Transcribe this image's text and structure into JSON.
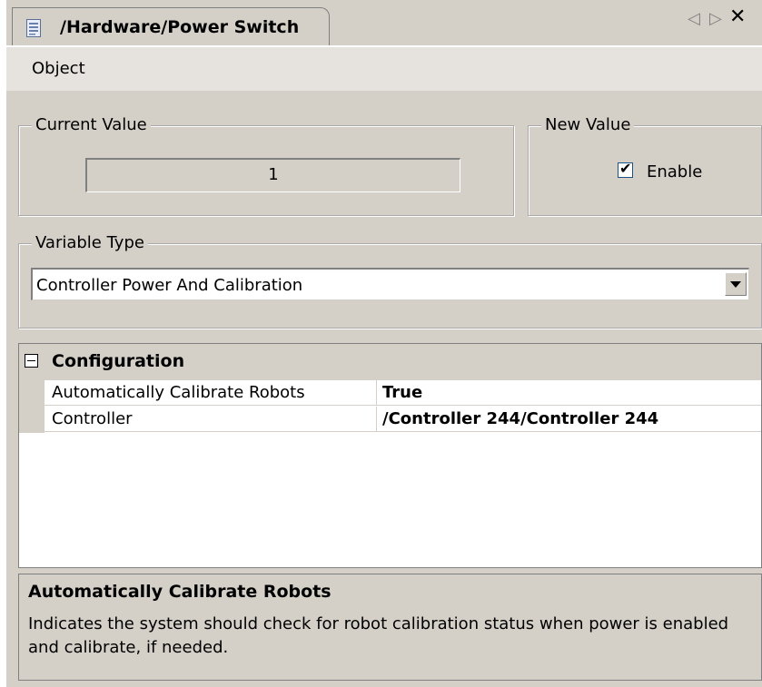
{
  "window": {
    "tab_title": "/Hardware/Power Switch",
    "tab_icon": "document-icon",
    "nav_left": "◁",
    "nav_right": "▷",
    "close": "✕"
  },
  "menu": {
    "items": [
      {
        "label": "Object"
      }
    ]
  },
  "current_value": {
    "legend": "Current Value",
    "value": "1"
  },
  "new_value": {
    "legend": "New Value",
    "checkbox_label": "Enable",
    "checked": true
  },
  "variable_type": {
    "legend": "Variable Type",
    "selected": "Controller Power And Calibration"
  },
  "property_grid": {
    "category": "Configuration",
    "rows": [
      {
        "name": "Automatically Calibrate Robots",
        "value": "True"
      },
      {
        "name": "Controller",
        "value": "/Controller 244/Controller 244"
      }
    ]
  },
  "description": {
    "title": "Automatically Calibrate Robots",
    "text": "Indicates the system should check for robot calibration status when power is enabled and calibrate, if needed."
  },
  "colors": {
    "panel": "#d4d0c8",
    "white": "#ffffff",
    "border": "#808080"
  }
}
